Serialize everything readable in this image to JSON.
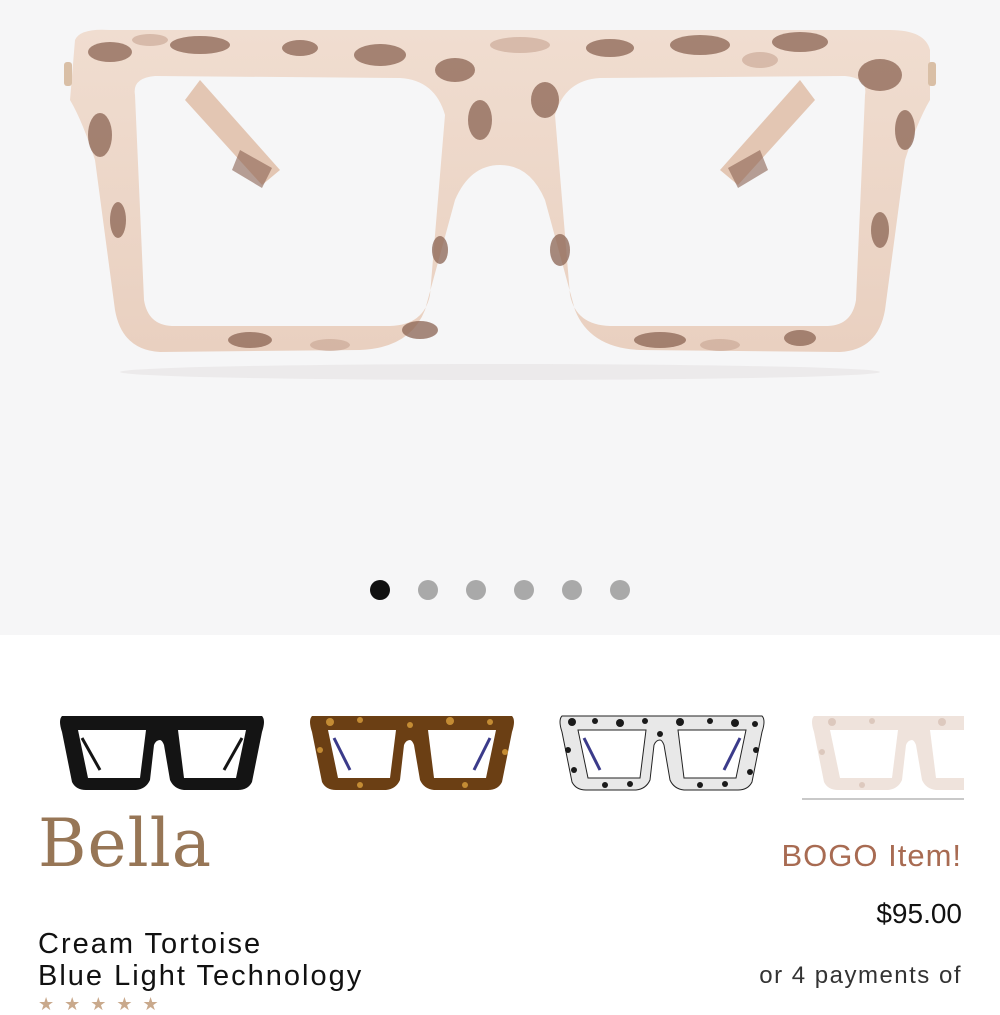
{
  "product": {
    "name": "Bella",
    "color_line": "Cream Tortoise",
    "feature_line": "Blue Light Technology",
    "promo": "BOGO Item!",
    "price": "$95.00",
    "installments": "or 4 payments of",
    "rating_stars": "★★★★★"
  },
  "gallery": {
    "image_count": 6,
    "active_index": 0
  },
  "swatches": [
    {
      "color_name": "Black",
      "selected": false
    },
    {
      "color_name": "Tortoise",
      "selected": false
    },
    {
      "color_name": "Snow Leopard",
      "selected": false
    },
    {
      "color_name": "Cream Tortoise",
      "selected": true
    }
  ],
  "colors": {
    "brand_name": "#977656",
    "promo": "#a86b52",
    "frame_cream": "#ecd6c8",
    "dot_active": "#111111",
    "dot_inactive": "#a9a9a9"
  }
}
